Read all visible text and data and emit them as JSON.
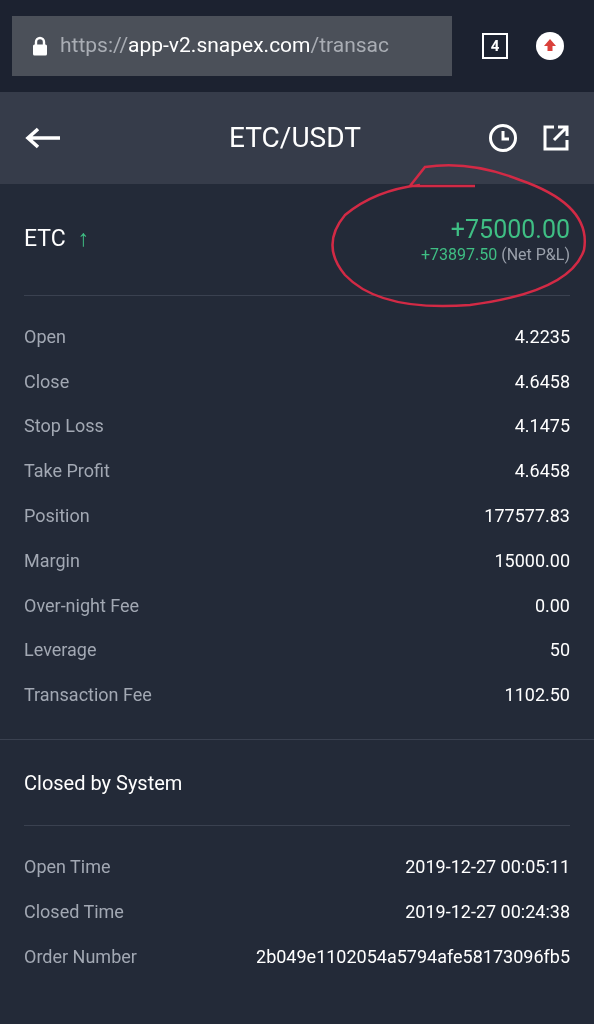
{
  "browser": {
    "url_scheme": "https://",
    "url_host": "app-v2.snapex.com",
    "url_path": "/transac",
    "tab_count": "4"
  },
  "header": {
    "title": "ETC/USDT"
  },
  "summary": {
    "symbol": "ETC",
    "direction": "↑",
    "profit": "+75000.00",
    "net_pnl": "+73897.50",
    "net_pnl_label": "(Net P&L)"
  },
  "details": [
    {
      "label": "Open",
      "value": "4.2235"
    },
    {
      "label": "Close",
      "value": "4.6458"
    },
    {
      "label": "Stop Loss",
      "value": "4.1475"
    },
    {
      "label": "Take Profit",
      "value": "4.6458"
    },
    {
      "label": "Position",
      "value": "177577.83"
    },
    {
      "label": "Margin",
      "value": "15000.00"
    },
    {
      "label": "Over-night Fee",
      "value": "0.00"
    },
    {
      "label": "Leverage",
      "value": "50"
    },
    {
      "label": "Transaction Fee",
      "value": "1102.50"
    }
  ],
  "close_reason": "Closed by System",
  "times": [
    {
      "label": "Open Time",
      "value": "2019-12-27 00:05:11"
    },
    {
      "label": "Closed Time",
      "value": "2019-12-27 00:24:38"
    },
    {
      "label": "Order Number",
      "value": "2b049e1102054a5794afe58173096fb5"
    }
  ]
}
